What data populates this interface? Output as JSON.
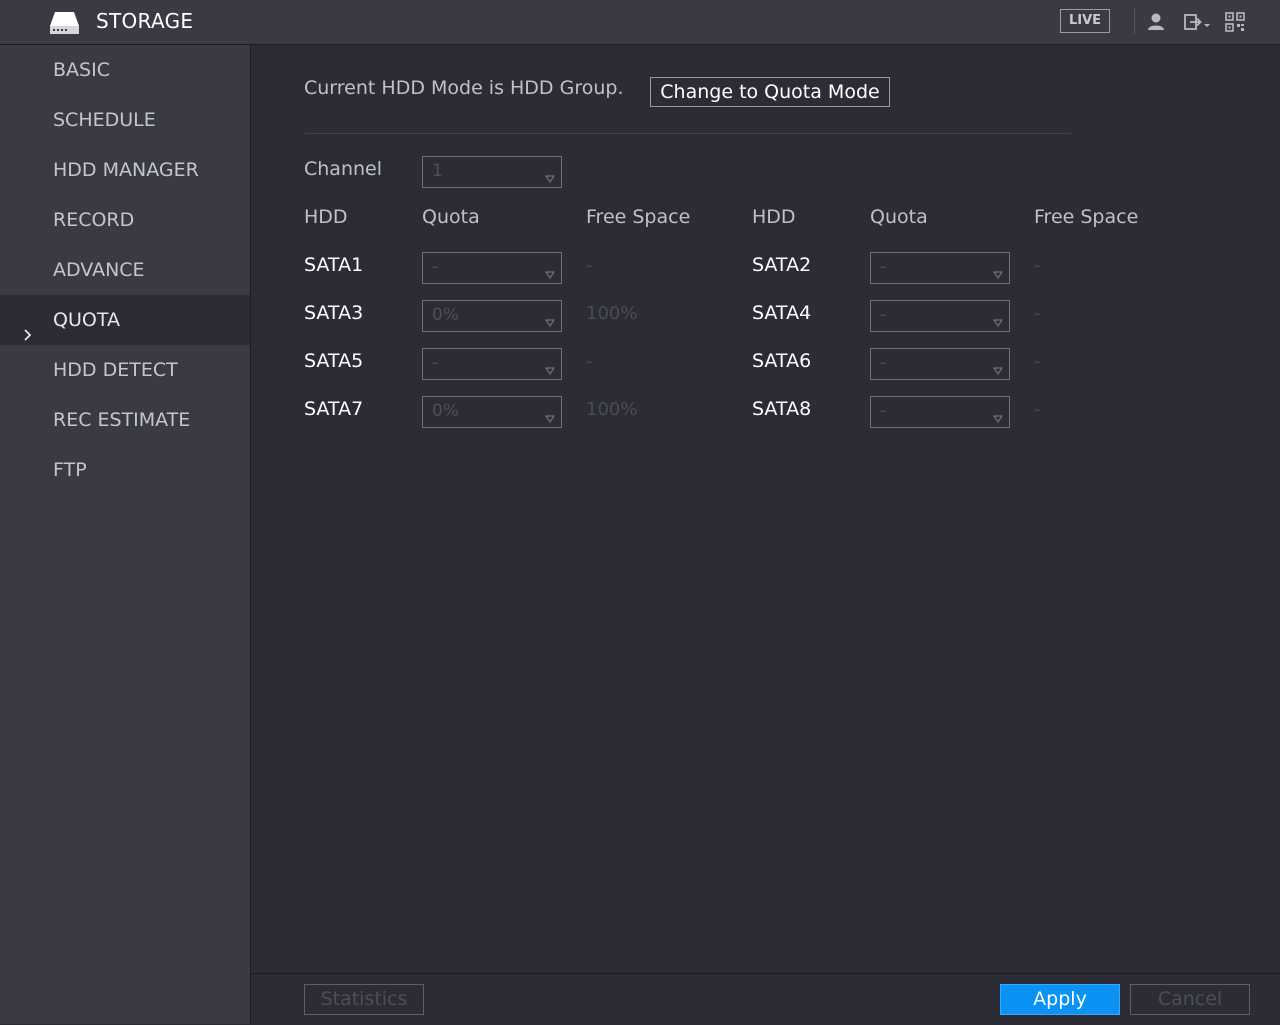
{
  "header": {
    "title": "STORAGE",
    "live_label": "LIVE",
    "icons": [
      "storage-drive-icon",
      "user-icon",
      "logout-icon",
      "qr-code-icon"
    ]
  },
  "sidebar": {
    "items": [
      {
        "label": "BASIC"
      },
      {
        "label": "SCHEDULE"
      },
      {
        "label": "HDD MANAGER"
      },
      {
        "label": "RECORD"
      },
      {
        "label": "ADVANCE"
      },
      {
        "label": "QUOTA",
        "active": true
      },
      {
        "label": "HDD DETECT"
      },
      {
        "label": "REC ESTIMATE"
      },
      {
        "label": "FTP"
      }
    ]
  },
  "main": {
    "mode_text": "Current HDD Mode is HDD Group.",
    "change_button": "Change to Quota Mode",
    "channel_label": "Channel",
    "channel_value": "1",
    "columns": {
      "hdd": "HDD",
      "quota": "Quota",
      "free_space": "Free Space"
    },
    "disks": [
      {
        "name": "SATA1",
        "quota": "-",
        "free": "-"
      },
      {
        "name": "SATA2",
        "quota": "-",
        "free": "-"
      },
      {
        "name": "SATA3",
        "quota": "0%",
        "free": "100%"
      },
      {
        "name": "SATA4",
        "quota": "-",
        "free": "-"
      },
      {
        "name": "SATA5",
        "quota": "-",
        "free": "-"
      },
      {
        "name": "SATA6",
        "quota": "-",
        "free": "-"
      },
      {
        "name": "SATA7",
        "quota": "0%",
        "free": "100%"
      },
      {
        "name": "SATA8",
        "quota": "-",
        "free": "-"
      }
    ]
  },
  "footer": {
    "statistics": "Statistics",
    "apply": "Apply",
    "cancel": "Cancel"
  },
  "colors": {
    "background": "#2b2c35",
    "panel": "#393a44",
    "accent": "#0a93f5"
  }
}
